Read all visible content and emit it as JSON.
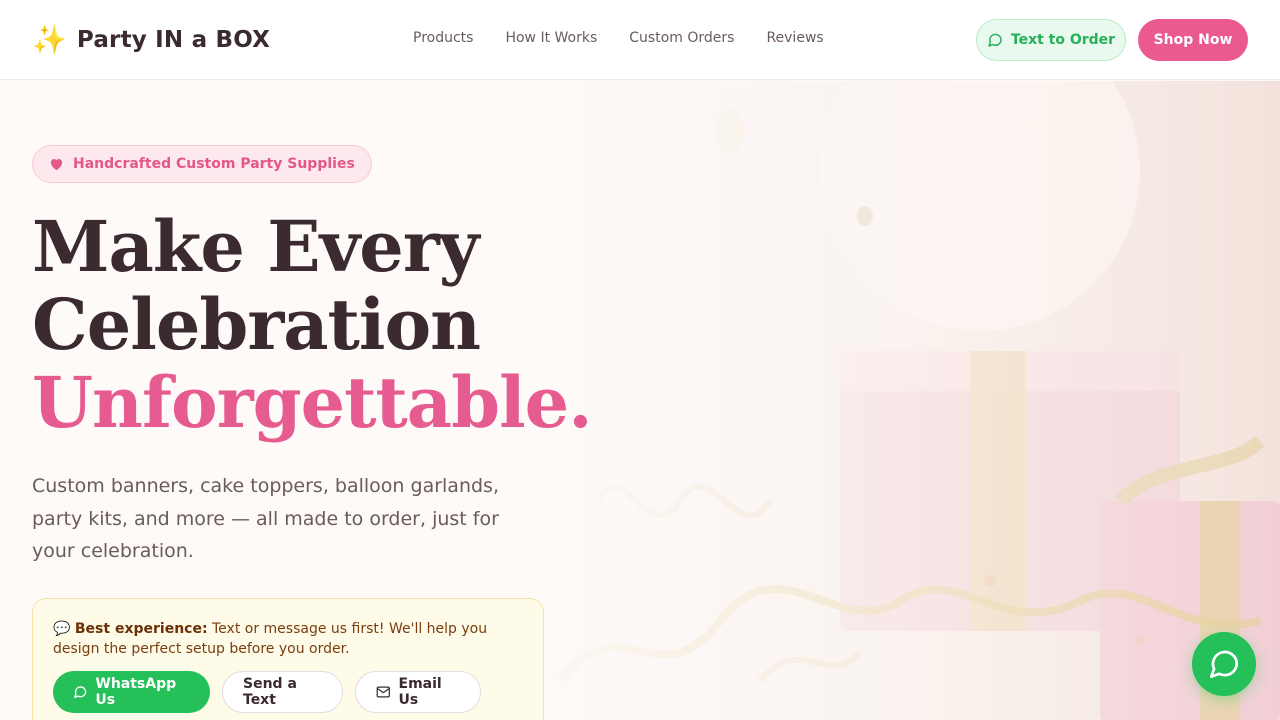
{
  "header": {
    "logo_icon": "sparkles-icon",
    "logo_text": "Party IN a BOX",
    "nav": [
      {
        "label": "Products"
      },
      {
        "label": "How It Works"
      },
      {
        "label": "Custom Orders"
      },
      {
        "label": "Reviews"
      }
    ],
    "text_to_order": "Text to Order",
    "shop_now": "Shop Now"
  },
  "hero": {
    "badge": "Handcrafted Custom Party Supplies",
    "headline_line1": "Make Every",
    "headline_line2": "Celebration",
    "headline_accent": "Unforgettable.",
    "subtext": "Custom banners, cake toppers, balloon garlands, party kits, and more — all made to order, just for your celebration.",
    "info_emoji": "💬",
    "info_bold": "Best experience:",
    "info_text": " Text or message us first! We'll help you design the perfect setup before you order.",
    "buttons": {
      "whatsapp": "WhatsApp Us",
      "text": "Send a Text",
      "email": "Email Us"
    }
  },
  "colors": {
    "brand_pink": "#e65b90",
    "whatsapp_green": "#25c05a",
    "dark_text": "#3b2a2f"
  }
}
